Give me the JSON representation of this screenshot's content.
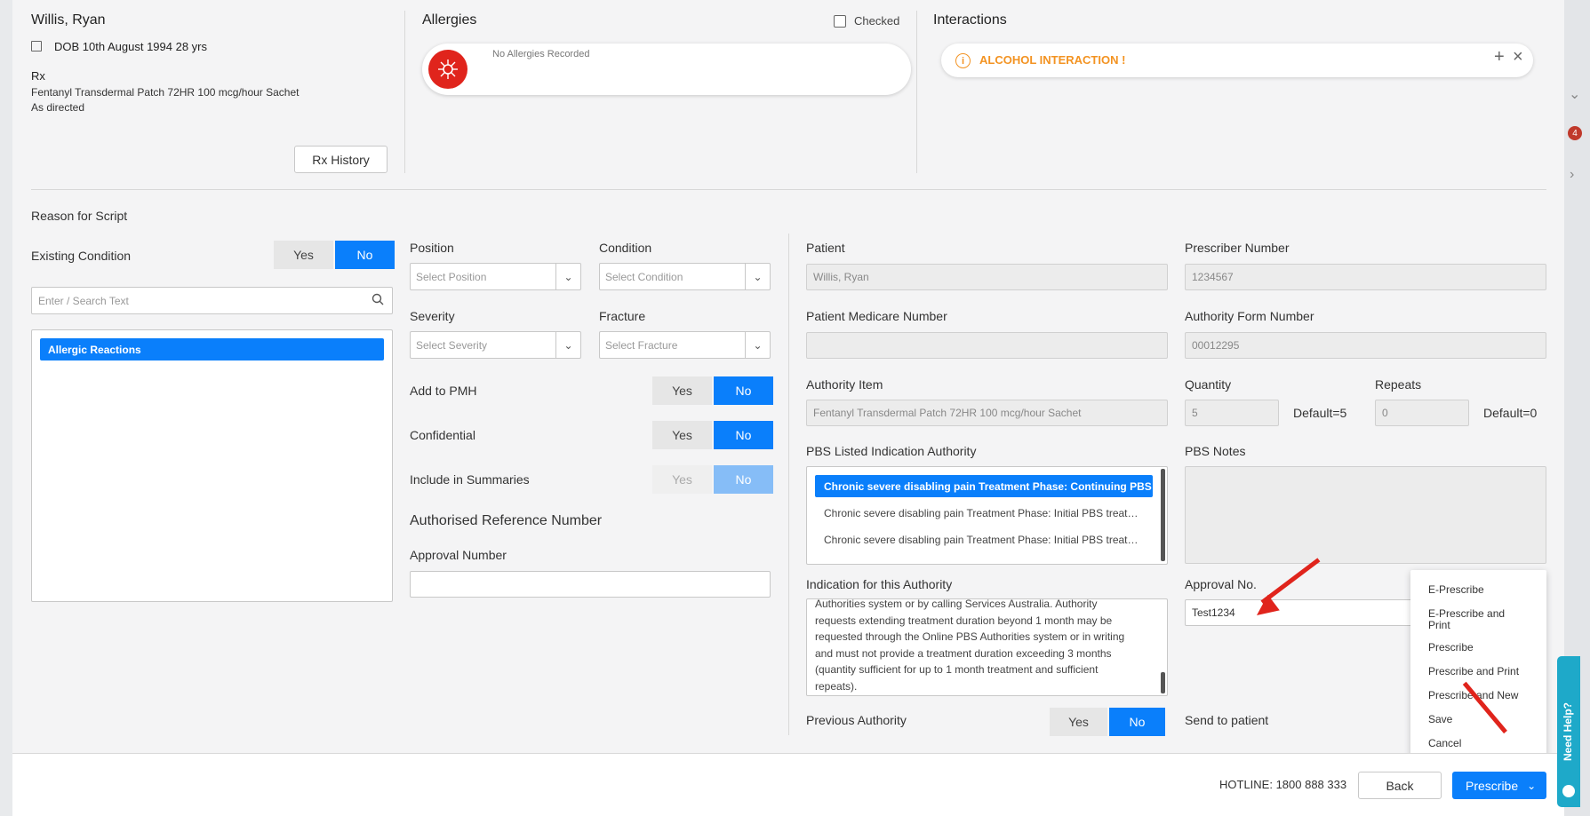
{
  "patient": {
    "name": "Willis, Ryan",
    "dob": "DOB 10th August 1994 28 yrs",
    "rx_label": "Rx",
    "rx_drug": "Fentanyl Transdermal Patch 72HR 100 mcg/hour Sachet",
    "rx_directions": "As directed",
    "rx_history_button": "Rx History"
  },
  "allergies": {
    "title": "Allergies",
    "checked_label": "Checked",
    "checked": false,
    "status": "No Allergies Recorded"
  },
  "interactions": {
    "title": "Interactions",
    "alert": "ALCOHOL INTERACTION !"
  },
  "reason": {
    "title": "Reason for Script",
    "existing_condition_label": "Existing Condition",
    "yes": "Yes",
    "no": "No",
    "search_placeholder": "Enter / Search Text",
    "conditions": [
      "Allergic Reactions"
    ]
  },
  "middle": {
    "position_label": "Position",
    "position_placeholder": "Select Position",
    "condition_label": "Condition",
    "condition_placeholder": "Select Condition",
    "severity_label": "Severity",
    "severity_placeholder": "Select Severity",
    "fracture_label": "Fracture",
    "fracture_placeholder": "Select Fracture",
    "add_to_pmh": "Add to PMH",
    "confidential": "Confidential",
    "include_in_summaries": "Include in Summaries",
    "authorised_ref_title": "Authorised Reference Number",
    "approval_number_label": "Approval Number",
    "approval_number_value": ""
  },
  "authority": {
    "patient_label": "Patient",
    "patient_value": "Willis, Ryan",
    "prescriber_number_label": "Prescriber Number",
    "prescriber_number_value": "1234567",
    "medicare_label": "Patient Medicare Number",
    "medicare_value": "",
    "authority_form_label": "Authority Form Number",
    "authority_form_value": "00012295",
    "authority_item_label": "Authority Item",
    "authority_item_value": "Fentanyl Transdermal Patch 72HR 100 mcg/hour Sachet",
    "quantity_label": "Quantity",
    "quantity_value": "5",
    "quantity_default": "Default=5",
    "repeats_label": "Repeats",
    "repeats_value": "0",
    "repeats_default": "Default=0",
    "pbs_indication_label": "PBS Listed Indication Authority",
    "pbs_indications": [
      "Chronic severe disabling pain Treatment Phase: Continuing PBS…",
      "Chronic severe disabling pain Treatment Phase: Initial PBS treat…",
      "Chronic severe disabling pain Treatment Phase: Initial PBS treat…"
    ],
    "pbs_notes_label": "PBS Notes",
    "indication_label": "Indication for this Authority",
    "indication_lines": [
      "Authorities system or by calling Services Australia. Authority",
      "requests extending treatment duration beyond 1 month may be",
      "requested through the Online PBS Authorities system or in writing",
      "and must not provide a treatment duration exceeding 3 months",
      "(quantity sufficient for up to 1 month treatment and sufficient",
      "repeats)."
    ],
    "approval_no_label": "Approval No.",
    "approval_no_value": "Test1234",
    "previous_authority_label": "Previous Authority",
    "send_to_patient_label": "Send to patient"
  },
  "prescribe_menu": [
    "E-Prescribe",
    "E-Prescribe and Print",
    "Prescribe",
    "Prescribe and Print",
    "Prescribe and New",
    "Save",
    "Cancel"
  ],
  "footer": {
    "hotline": "HOTLINE: 1800 888 333",
    "back": "Back",
    "prescribe": "Prescribe"
  },
  "help": {
    "label": "Need Help?"
  },
  "colors": {
    "primary": "#0a7ffb",
    "alert_orange": "#f39322",
    "allergy_red": "#e0241c"
  }
}
